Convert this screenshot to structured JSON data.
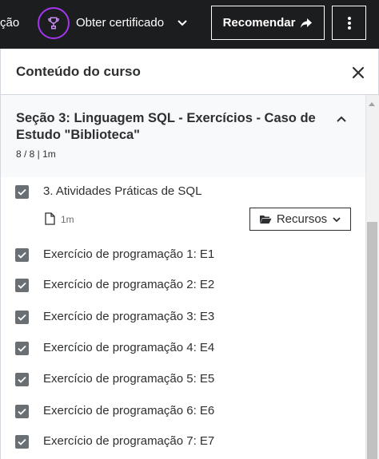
{
  "topbar": {
    "left_truncated_text": "ção",
    "certificate_label": "Obter certificado",
    "recommend_label": "Recomendar"
  },
  "panel": {
    "title": "Conteúdo do curso"
  },
  "section": {
    "title": "Seção 3: Linguagem SQL - Exercícios - Caso de Estudo \"Biblioteca\"",
    "meta": "8 / 8 | 1m"
  },
  "lessons": [
    {
      "label": "3. Atividades Práticas de SQL",
      "duration": "1m",
      "resources_label": "Recursos",
      "completed": true
    },
    {
      "label": "Exercício de programação 1: E1",
      "completed": true
    },
    {
      "label": "Exercício de programação 2: E2",
      "completed": true
    },
    {
      "label": "Exercício de programação 3: E3",
      "completed": true
    },
    {
      "label": "Exercício de programação 4: E4",
      "completed": true
    },
    {
      "label": "Exercício de programação 5: E5",
      "completed": true
    },
    {
      "label": "Exercício de programação 6: E6",
      "completed": true
    },
    {
      "label": "Exercício de programação 7: E7",
      "completed": true
    }
  ],
  "icons": {
    "certificate": "trophy-icon",
    "certificate_dropdown": "chevron-down-icon",
    "recommend": "share-arrow-icon",
    "more": "vertical-dots-icon",
    "close": "close-icon",
    "section_toggle": "chevron-up-icon",
    "lesson_type": "file-icon",
    "resources": "folder-open-icon",
    "resources_dropdown": "chevron-down-icon",
    "checkbox": "check-icon"
  },
  "colors": {
    "topbar_bg": "#1c1d1f",
    "accent_purple": "#a435f0",
    "section_bg": "#f7f9fa",
    "checkbox_fill": "#6a6f73",
    "text": "#2d2f31"
  }
}
